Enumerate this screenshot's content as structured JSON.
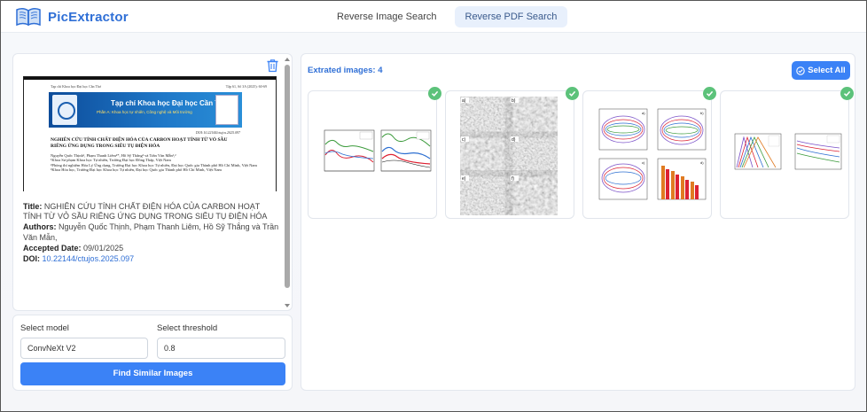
{
  "app": {
    "name": "PicExtractor",
    "nav_tabs": [
      {
        "label": "Reverse Image Search",
        "active": false
      },
      {
        "label": "Reverse PDF Search",
        "active": true
      }
    ]
  },
  "document": {
    "preview": {
      "journal_header_left": "Tạp chí Khoa học Đại học Cần Thơ",
      "journal_header_right": "Tập 61, Số 3A (2025): 60-69",
      "banner_title": "Tạp chí Khoa học Đại học Cần Thơ",
      "banner_subtitle": "Phần A: Khoa học tự nhiên, Công nghệ và Môi trường",
      "doi": "DOI:10.22144/ctujos.2025.097",
      "title": "NGHIÊN CỨU TÍNH CHẤT ĐIỆN HÓA CỦA CARBON HOẠT TÍNH TỪ VỎ SẦU RIÊNG ỨNG DỤNG TRONG SIÊU TỤ ĐIỆN HÓA",
      "authors": "Nguyễn Quốc Thịnh¹, Phạm Thanh Liêm²*, Hồ Sỹ Thắng³ và Trần Văn Mẫn¹,²",
      "affiliations": [
        "¹Khoa Sư phạm Khoa học Tự nhiên, Trường Đại học Đồng Tháp, Việt Nam",
        "²Phòng thí nghiệm Hóa Lý Ứng dụng, Trường Đại học Khoa học Tự nhiên, Đại học Quốc gia Thành phố Hồ Chí Minh, Việt Nam",
        "³Khoa Hóa học, Trường Đại học Khoa học Tự nhiên, Đại học Quốc gia Thành phố Hồ Chí Minh, Việt Nam"
      ]
    },
    "meta": {
      "title_label": "Title:",
      "title": "NGHIÊN CỨU TÍNH CHẤT ĐIỆN HÓA CỦA CARBON HOẠT TÍNH TỪ VỎ SẦU RIÊNG ỨNG DỤNG TRONG SIÊU TỤ ĐIỆN HÓA",
      "authors_label": "Authors:",
      "authors": "Nguyễn Quốc Thịnh, Phạm Thanh Liêm, Hồ Sỹ Thắng và Trần Văn Mẫn,",
      "accepted_label": "Accepted Date:",
      "accepted": "09/01/2025",
      "doi_label": "DOI:",
      "doi": "10.22144/ctujos.2025.097"
    }
  },
  "controls": {
    "model_label": "Select model",
    "model_value": "ConvNeXt V2",
    "threshold_label": "Select threshold",
    "threshold_value": "0.8",
    "find_button": "Find Similar Images"
  },
  "results": {
    "extracted_label": "Extrated images: 4",
    "select_all_label": "Select All",
    "images": [
      {
        "kind": "line-plots",
        "selected": true
      },
      {
        "kind": "sem-micrographs",
        "selected": true,
        "panel_labels": [
          "a)",
          "b)",
          "c)",
          "d)",
          "e)",
          "f)"
        ]
      },
      {
        "kind": "cv-curves",
        "selected": true,
        "panel_labels": [
          "a)",
          "b)",
          "c)",
          "d)"
        ]
      },
      {
        "kind": "gcd-curves",
        "selected": true
      }
    ]
  },
  "colors": {
    "brand": "#2f6fd6",
    "button": "#3b82f6",
    "check": "#5cc27a"
  },
  "icons": [
    "book-logo-icon",
    "trash-icon",
    "check-circle-icon",
    "check-icon"
  ]
}
